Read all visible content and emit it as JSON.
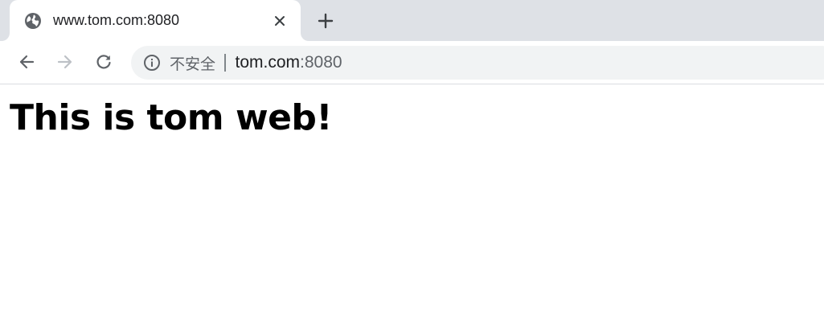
{
  "tab": {
    "title": "www.tom.com:8080",
    "favicon": "globe-icon",
    "close_icon": "close-icon"
  },
  "tabstrip": {
    "new_tab_icon": "plus-icon"
  },
  "toolbar": {
    "back_icon": "arrow-left-icon",
    "forward_icon": "arrow-right-icon",
    "reload_icon": "reload-icon"
  },
  "omnibox": {
    "security_icon": "info-icon",
    "security_label": "不安全",
    "url_host": "tom.com",
    "url_port": ":8080"
  },
  "page": {
    "heading": "This is tom web!"
  },
  "colors": {
    "tabstrip_bg": "#dee1e6",
    "omnibox_bg": "#f1f3f4",
    "icon_gray": "#5f6368",
    "icon_disabled": "#bdc1c6",
    "text_dark": "#202124"
  }
}
